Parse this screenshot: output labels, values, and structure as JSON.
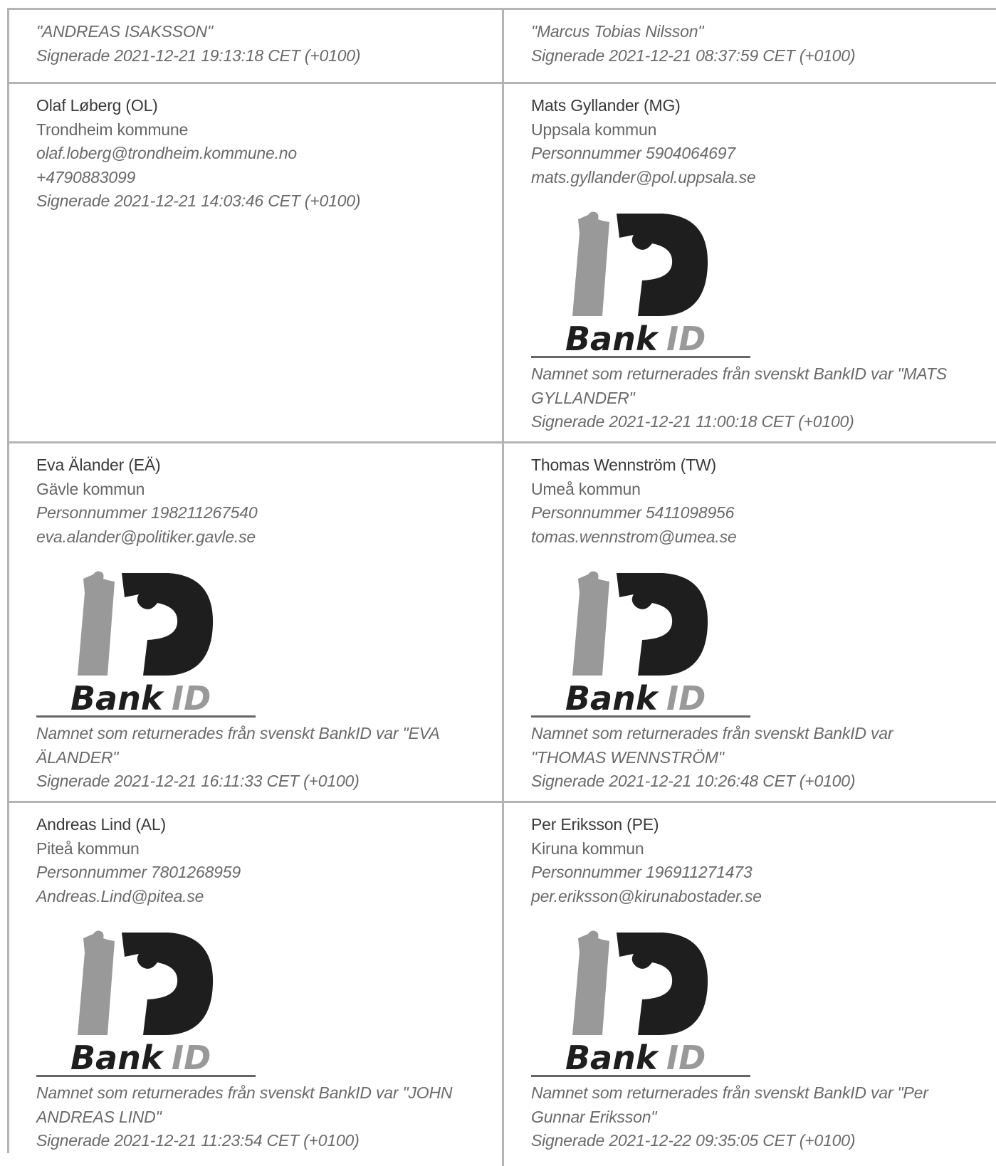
{
  "top_left": {
    "name_returned": "\"ANDREAS ISAKSSON\"",
    "signed": "Signerade 2021-12-21 19:13:18 CET (+0100)"
  },
  "top_right": {
    "name_returned": "\"Marcus Tobias Nilsson\"",
    "signed": "Signerade 2021-12-21 08:37:59 CET (+0100)"
  },
  "signers": [
    {
      "name": "Olaf Løberg (OL)",
      "org": "Trondheim kommune",
      "email": "olaf.loberg@trondheim.kommune.no",
      "phone": "+4790883099",
      "signed": "Signerade 2021-12-21 14:03:46 CET (+0100)"
    },
    {
      "name": "Mats Gyllander (MG)",
      "org": "Uppsala kommun",
      "personnummer": "Personnummer 5904064697",
      "email": "mats.gyllander@pol.uppsala.se",
      "bankid_note": "Namnet som returnerades från svenskt BankID var \"MATS GYLLANDER\"",
      "signed": "Signerade 2021-12-21 11:00:18 CET (+0100)"
    },
    {
      "name": "Eva Älander (EÄ)",
      "org": "Gävle kommun",
      "personnummer": "Personnummer 198211267540",
      "email": "eva.alander@politiker.gavle.se",
      "bankid_note": "Namnet som returnerades från svenskt BankID var \"EVA ÄLANDER\"",
      "signed": "Signerade 2021-12-21 16:11:33 CET (+0100)"
    },
    {
      "name": "Thomas Wennström (TW)",
      "org": "Umeå kommun",
      "personnummer": "Personnummer 5411098956",
      "email": "tomas.wennstrom@umea.se",
      "bankid_note": "Namnet som returnerades från svenskt BankID var \"THOMAS WENNSTRÖM\"",
      "signed": "Signerade 2021-12-21 10:26:48 CET (+0100)"
    },
    {
      "name": "Andreas Lind (AL)",
      "org": "Piteå kommun",
      "personnummer": "Personnummer 7801268959",
      "email": "Andreas.Lind@pitea.se",
      "bankid_note": "Namnet som returnerades från svenskt BankID var \"JOHN ANDREAS LIND\"",
      "signed": "Signerade 2021-12-21 11:23:54 CET (+0100)"
    },
    {
      "name": "Per Eriksson (PE)",
      "org": "Kiruna kommun",
      "personnummer": "Personnummer 196911271473",
      "email": "per.eriksson@kirunabostader.se",
      "bankid_note": "Namnet som returnerades från svenskt BankID var \"Per Gunnar Eriksson\"",
      "signed": "Signerade 2021-12-22 09:35:05 CET (+0100)"
    }
  ],
  "logo": {
    "text_bank": "Bank",
    "text_id": "ID",
    "icon": "bankid-logo",
    "dark_color": "#1e1e1e",
    "gray_color": "#999999"
  }
}
